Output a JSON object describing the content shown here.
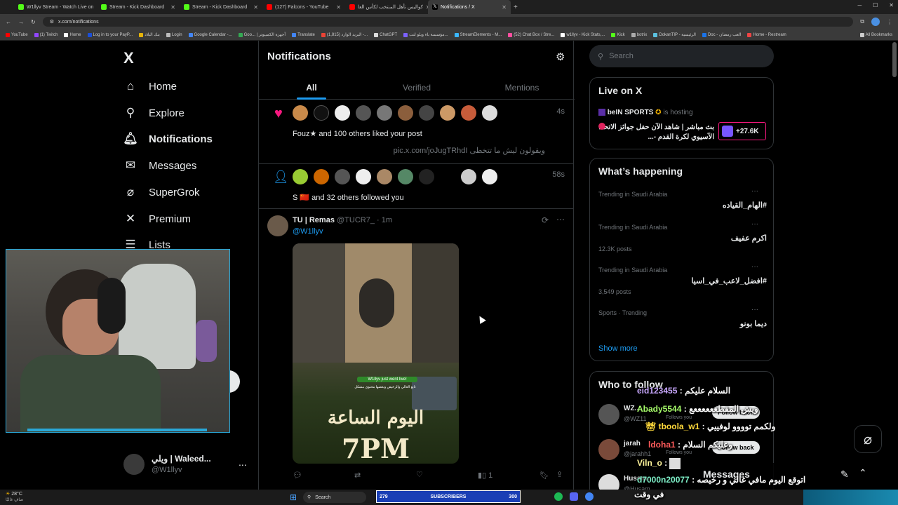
{
  "browser": {
    "tabs": [
      {
        "title": "W1llyv Stream - Watch Live on",
        "color": "#53fc18"
      },
      {
        "title": "Stream - Kick Dashboard",
        "color": "#53fc18"
      },
      {
        "title": "Stream - Kick Dashboard",
        "color": "#53fc18"
      },
      {
        "title": "(127) Falcons - YouTube",
        "color": "#ff0000"
      },
      {
        "title": "كواليس تأهل المنتخب لكأس العا",
        "color": "#ff0000"
      },
      {
        "title": "Notifications / X",
        "color": "#ffffff"
      }
    ],
    "new_tab": "+",
    "url": "x.com/notifications",
    "bookmarks": [
      "YouTube",
      "(1) Twitch",
      "Home",
      "Log in to your PayP...",
      "بنك البلاد",
      "Login",
      "Google Calendar -...",
      "Goo... | أجهزة الكمبيوتر",
      "Translate",
      "البريد الوارد (1,815) -...",
      "ChatGPT",
      "مؤسسة باء ويلو لتت...",
      "StreamElements - M...",
      "(52) Chat Box / Stre...",
      "w1llyv - Kick Stats,...",
      "Kick",
      "botrix",
      "DokanTIP - الرئيسية",
      "Doc - العب رمضان",
      "Home - Restream"
    ],
    "all_bookmarks": "All Bookmarks"
  },
  "nav": {
    "logo": "X",
    "items": [
      {
        "label": "Home",
        "icon": "home-icon"
      },
      {
        "label": "Explore",
        "icon": "search-icon"
      },
      {
        "label": "Notifications",
        "icon": "bell-icon"
      },
      {
        "label": "Messages",
        "icon": "mail-icon"
      },
      {
        "label": "SuperGrok",
        "icon": "grok-icon"
      },
      {
        "label": "Premium",
        "icon": "x-icon"
      },
      {
        "label": "Lists",
        "icon": "list-icon"
      }
    ],
    "account": {
      "name": "ويلي | Waleed...",
      "handle": "@W1llyv",
      "more": "..."
    }
  },
  "center": {
    "title": "Notifications",
    "tabs": [
      "All",
      "Verified",
      "Mentions"
    ],
    "notif1": {
      "text": "Fouz★ and 100 others liked your post",
      "time": "4s",
      "quote": "ويقولون ليش ما تتخطى  pic.x.com/joJugTRhdI"
    },
    "notif2": {
      "text": "S 🇨🇳 and 32 others followed you",
      "time": "58s"
    },
    "post": {
      "name": "TU | Remas",
      "handle": "@TUCR7_",
      "time": "· 1m",
      "mention": "@W1llyv",
      "image_badge": "W1llyv just went live!",
      "image_sub": "تابع الغالي والرخيص وبعضها محتوى مشكل",
      "image_arabic": "اليوم الساعة",
      "image_time": "7PM",
      "views": "1"
    }
  },
  "right": {
    "search_placeholder": "Search",
    "live": {
      "heading": "Live on X",
      "host": "beIN SPORTS",
      "hosting": "is hosting",
      "title": "بث مباشر | شاهد الآن حفل جوائز الاتحاد الآسيوي لكرة القدم -...",
      "count": "+27.6K"
    },
    "happening": {
      "heading": "What’s happening",
      "trends": [
        {
          "meta": "Trending in Saudi Arabia",
          "tag": "#الهام_القياده",
          "posts": ""
        },
        {
          "meta": "Trending in Saudi Arabia",
          "tag": "اكرم عفيف",
          "posts": "12.3K posts"
        },
        {
          "meta": "Trending in Saudi Arabia",
          "tag": "#افضل_لاعب_في_اسيا",
          "posts": "3,549 posts"
        },
        {
          "meta": "Sports · Trending",
          "tag": "ديما بونو",
          "posts": ""
        }
      ],
      "show_more": "Show more"
    },
    "who": {
      "heading": "Who to follow",
      "users": [
        {
          "name": "WZ...",
          "handle": "@WZ11",
          "button": "Follow back",
          "follows": "Follows you"
        },
        {
          "name": "jarah",
          "handle": "@jarahh1",
          "button": "Follow back",
          "follows": "Follows you"
        },
        {
          "name": "Husam",
          "handle": "@Husam...",
          "button": "",
          "follows": ""
        }
      ]
    },
    "messages_label": "Messages"
  },
  "chat": [
    {
      "user": "eid123455",
      "text": ": السلام عليكم",
      "color": "#c9a8ff"
    },
    {
      "user": "Abady5544",
      "text": ": ويش المقطععععععع",
      "color": "#a8ff6b"
    },
    {
      "user": "tboola_w1",
      "text": ": ولكمم توووو لوفييي",
      "color": "#ffd93b"
    },
    {
      "user": "ldoha1",
      "text": ": وعليكم السلام",
      "color": "#ff5b5b"
    },
    {
      "user": "Viln_o",
      "text": ":",
      "color": "#fff59b"
    },
    {
      "user": "d7000n20077",
      "text": ": اتوقع اليوم مافي غالي و رخيصه",
      "color": "#7ef0c8"
    },
    {
      "user": "",
      "text": "في وقت",
      "color": "#ffffff"
    }
  ],
  "taskbar": {
    "weather": "28°C",
    "weather_sub": "صافٍ غالبًا",
    "search": "Search",
    "subs_count": "279",
    "subs_label": "SUBSCRIBERS",
    "subs_goal": "300"
  }
}
